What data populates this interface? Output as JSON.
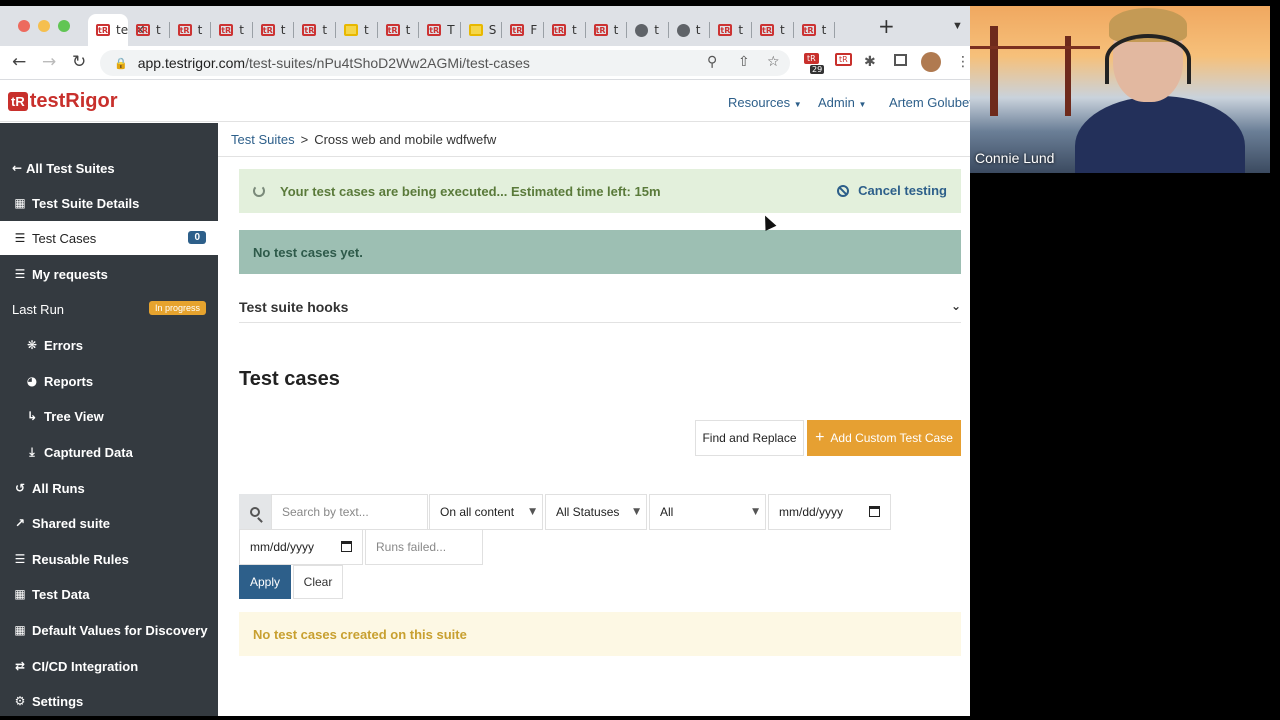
{
  "browser": {
    "tabs": [
      {
        "title": "te",
        "favicon": "testrigor-icon"
      },
      {
        "title": "t",
        "favicon": "testrigor-icon"
      },
      {
        "title": "t",
        "favicon": "testrigor-icon"
      },
      {
        "title": "t",
        "favicon": "testrigor-icon"
      },
      {
        "title": "t",
        "favicon": "testrigor-icon"
      },
      {
        "title": "t",
        "favicon": "testrigor-icon"
      },
      {
        "title": "t",
        "favicon": "slides-icon"
      },
      {
        "title": "t",
        "favicon": "testrigor-icon"
      },
      {
        "title": "T",
        "favicon": "testrigor-icon"
      },
      {
        "title": "S",
        "favicon": "slides-icon"
      },
      {
        "title": "F",
        "favicon": "testrigor-icon"
      },
      {
        "title": "t",
        "favicon": "testrigor-icon"
      },
      {
        "title": "t",
        "favicon": "testrigor-icon"
      },
      {
        "title": "t",
        "favicon": "globe-icon"
      },
      {
        "title": "t",
        "favicon": "globe-icon"
      },
      {
        "title": "t",
        "favicon": "testrigor-icon"
      },
      {
        "title": "t",
        "favicon": "testrigor-icon"
      },
      {
        "title": "t",
        "favicon": "testrigor-icon"
      }
    ],
    "new_tab": "+",
    "url_host": "app.testrigor.com",
    "url_path": "/test-suites/nPu4tShoD2Ww2AGMi/test-cases",
    "extension_badge": "29"
  },
  "header": {
    "logo_mark": "tR",
    "logo_text": "testRigor",
    "nav": [
      "Resources",
      "Admin",
      "Artem Golubev"
    ]
  },
  "sidebar": {
    "items": [
      {
        "label": "All Test Suites",
        "icon": "arrow-left-icon"
      },
      {
        "label": "Test Suite Details",
        "icon": "grid-icon"
      },
      {
        "label": "Test Cases",
        "icon": "list-icon",
        "badge": "0"
      },
      {
        "label": "My requests",
        "icon": "list-icon"
      },
      {
        "label": "Last Run",
        "badge": "In progress"
      },
      {
        "label": "Errors",
        "icon": "bug-icon"
      },
      {
        "label": "Reports",
        "icon": "pie-chart-icon"
      },
      {
        "label": "Tree View",
        "icon": "tree-icon"
      },
      {
        "label": "Captured Data",
        "icon": "download-icon"
      },
      {
        "label": "All Runs",
        "icon": "history-icon"
      },
      {
        "label": "Shared suite",
        "icon": "share-icon"
      },
      {
        "label": "Reusable Rules",
        "icon": "list-numbered-icon"
      },
      {
        "label": "Test Data",
        "icon": "table-icon"
      },
      {
        "label": "Default Values for Discovery",
        "icon": "table-icon"
      },
      {
        "label": "CI/CD Integration",
        "icon": "shuffle-icon"
      },
      {
        "label": "Settings",
        "icon": "gears-icon"
      }
    ]
  },
  "main": {
    "breadcrumb": {
      "root": "Test Suites",
      "sep": ">",
      "current": "Cross web and mobile wdfwefw"
    },
    "execution_banner": "Your test cases are being executed... Estimated time left: 15m",
    "cancel_testing": "Cancel testing",
    "no_test_cases": "No test cases yet.",
    "hooks_label": "Test suite hooks",
    "section_title": "Test cases",
    "find_replace": "Find and Replace",
    "add_custom": "Add Custom Test Case",
    "filters": {
      "search_placeholder": "Search by text...",
      "content_select": "On all content",
      "status_select": "All Statuses",
      "all_select": "All",
      "date_from": "mm/dd/yyyy",
      "date_to": "mm/dd/yyyy",
      "runs_failed_placeholder": "Runs failed..."
    },
    "apply": "Apply",
    "clear": "Clear",
    "no_created": "No test cases created on this suite"
  },
  "video": {
    "participant": "Connie Lund"
  }
}
